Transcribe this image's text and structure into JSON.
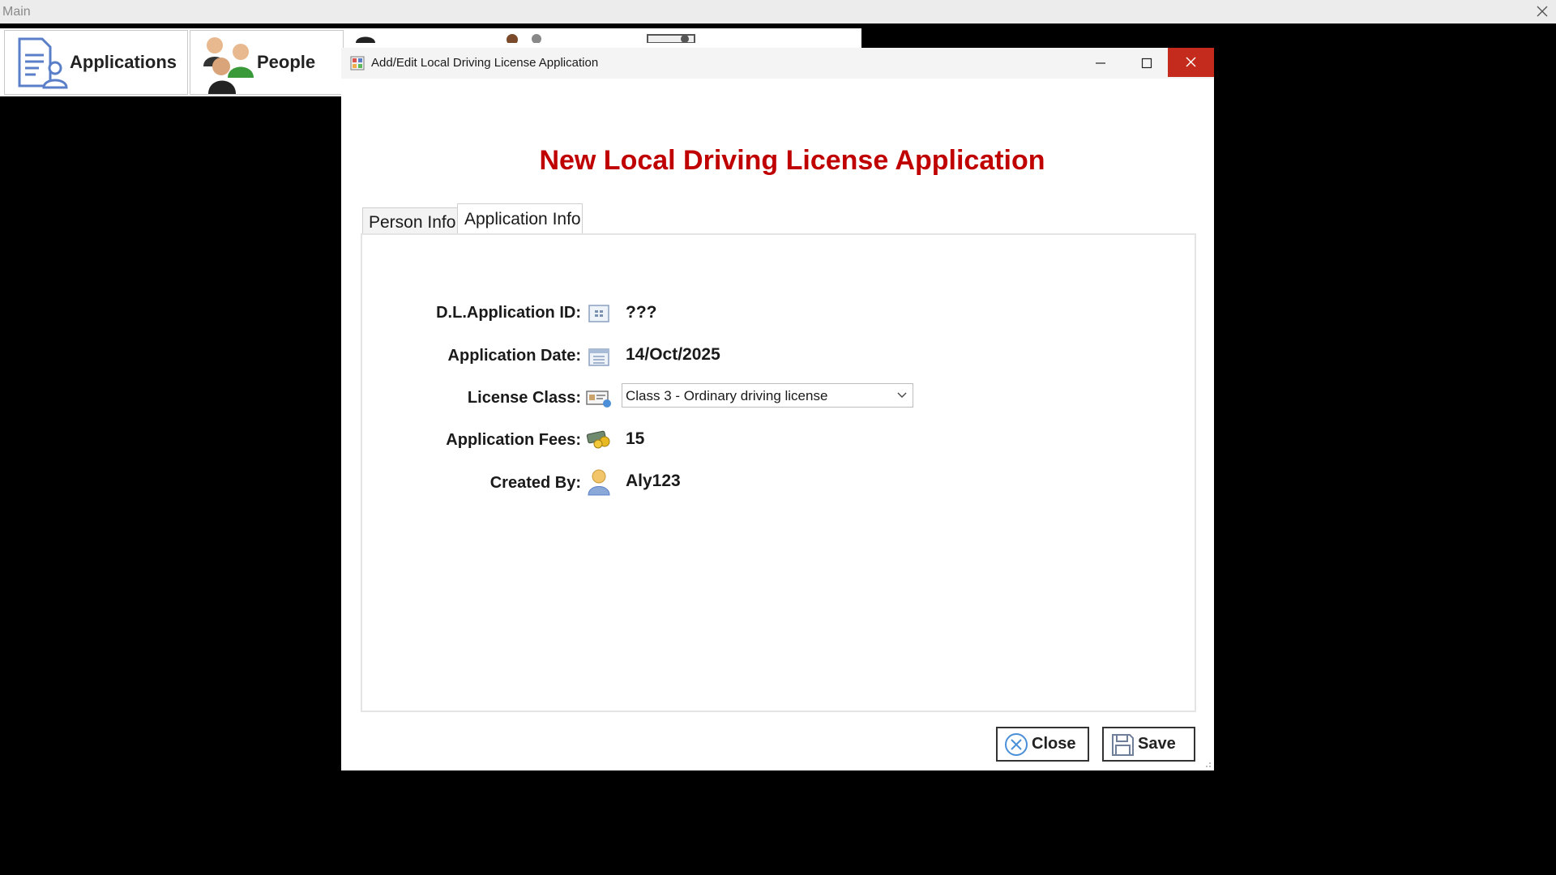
{
  "main_window": {
    "title": "Main"
  },
  "toolbar": {
    "applications_label": "Applications",
    "people_label": "People"
  },
  "dialog": {
    "title": "Add/Edit Local Driving License Application",
    "heading": "New Local Driving License Application",
    "tabs": [
      {
        "label": "Person Info",
        "selected": false
      },
      {
        "label": "Application Info",
        "selected": true
      }
    ],
    "fields": {
      "application_id": {
        "label": "D.L.Application ID:",
        "value": "???"
      },
      "application_date": {
        "label": "Application Date:",
        "value": "14/Oct/2025"
      },
      "license_class": {
        "label": "License Class:",
        "value": "Class 3 - Ordinary driving license"
      },
      "application_fees": {
        "label": "Application Fees:",
        "value": "15"
      },
      "created_by": {
        "label": "Created By:",
        "value": "Aly123"
      }
    },
    "buttons": {
      "close_label": "Close",
      "save_label": "Save"
    }
  },
  "colors": {
    "heading": "#c00000",
    "close_button_bg": "#c42b1c",
    "background": "#000000"
  }
}
